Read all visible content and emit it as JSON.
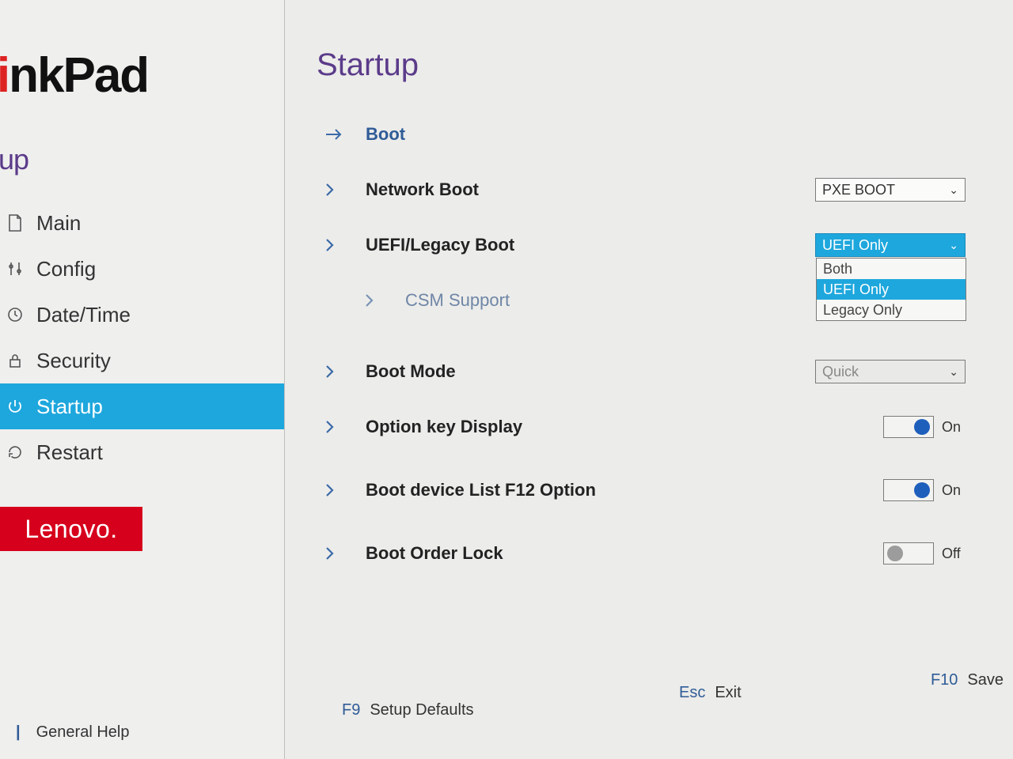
{
  "brand": {
    "name_prefix": "hinkPad"
  },
  "sidebar": {
    "heading": "etup",
    "items": [
      {
        "label": "Main"
      },
      {
        "label": "Config"
      },
      {
        "label": "Date/Time"
      },
      {
        "label": "Security"
      },
      {
        "label": "Startup"
      },
      {
        "label": "Restart"
      }
    ],
    "vendor": "Lenovo."
  },
  "main": {
    "title": "Startup",
    "boot_link": "Boot",
    "items": {
      "network_boot": {
        "label": "Network Boot",
        "value": "PXE BOOT"
      },
      "uefi_legacy": {
        "label": "UEFI/Legacy Boot",
        "value": "UEFI Only",
        "options": [
          "Both",
          "UEFI Only",
          "Legacy Only"
        ]
      },
      "csm_support": {
        "label": "CSM Support"
      },
      "boot_mode": {
        "label": "Boot Mode",
        "value": "Quick"
      },
      "option_key": {
        "label": "Option key Display",
        "value": "On"
      },
      "boot_f12": {
        "label": "Boot device List F12 Option",
        "value": "On"
      },
      "boot_lock": {
        "label": "Boot Order Lock",
        "value": "Off"
      }
    }
  },
  "footer": {
    "help": {
      "label": "General Help"
    },
    "defaults": {
      "key": "F9",
      "label": "Setup Defaults"
    },
    "exit": {
      "key": "Esc",
      "label": "Exit"
    },
    "save": {
      "key": "F10",
      "label": "Save"
    }
  }
}
